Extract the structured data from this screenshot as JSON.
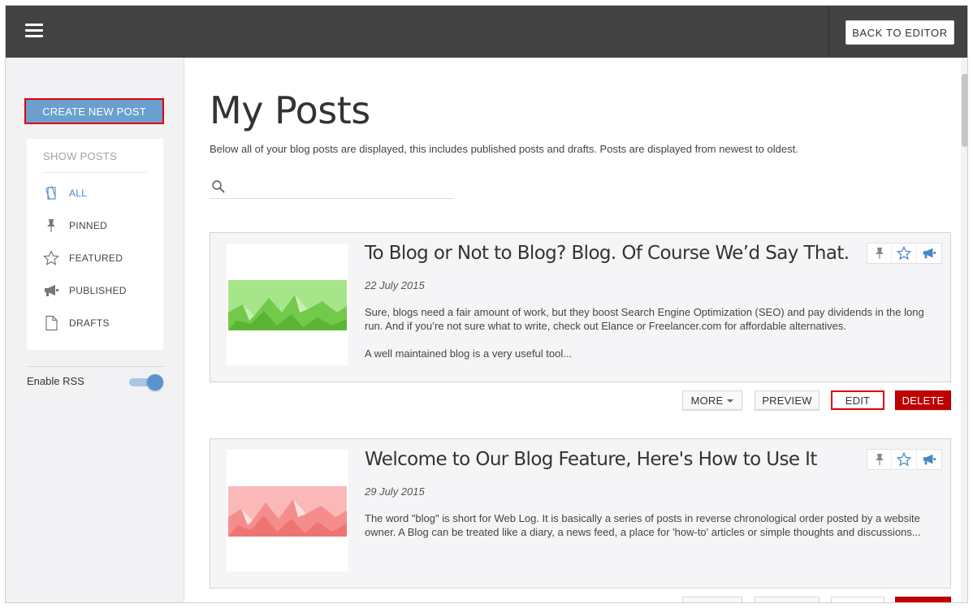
{
  "topbar": {
    "back_label": "BACK TO EDITOR"
  },
  "sidebar": {
    "create_label": "CREATE NEW POST",
    "filter_title": "SHOW POSTS",
    "filters": [
      {
        "label": "ALL",
        "icon": "all-posts-icon",
        "active": true
      },
      {
        "label": "PINNED",
        "icon": "pin-icon",
        "active": false
      },
      {
        "label": "FEATURED",
        "icon": "star-icon",
        "active": false
      },
      {
        "label": "PUBLISHED",
        "icon": "megaphone-icon",
        "active": false
      },
      {
        "label": "DRAFTS",
        "icon": "document-icon",
        "active": false
      }
    ],
    "rss_label": "Enable RSS",
    "rss_enabled": true
  },
  "main": {
    "title": "My Posts",
    "description": "Below all of your blog posts are displayed, this includes published posts and drafts. Posts are displayed from newest to oldest.",
    "search_placeholder": "",
    "posts": [
      {
        "title": "To Blog or Not to Blog? Blog. Of Course We’d Say That.",
        "date": "22 July 2015",
        "excerpt": [
          "Sure, blogs need a fair amount of work, but they boost Search Engine Optimization (SEO) and pay dividends in the long run. And if you’re not sure what to write, check out Elance or Freelancer.com for affordable alternatives.",
          "A well maintained blog is a very useful tool..."
        ],
        "thumb_color": "#8fd96a"
      },
      {
        "title": "Welcome to Our Blog Feature, Here's How to Use It",
        "date": "29 July 2015",
        "excerpt": [
          "The word \"blog\" is short for Web Log. It is basically a series of posts in reverse chronological order posted by a website owner. A Blog can be treated like a diary, a news feed, a place for 'how-to' articles or simple thoughts and discussions..."
        ],
        "thumb_color": "#f59a9a"
      }
    ],
    "actions": {
      "more_label": "MORE",
      "preview_label": "PREVIEW",
      "edit_label": "EDIT",
      "delete_label": "DELETE"
    }
  },
  "colors": {
    "topbar": "#424242",
    "accent": "#6b9fd0",
    "delete": "#c00000",
    "highlight": "#e00000"
  }
}
